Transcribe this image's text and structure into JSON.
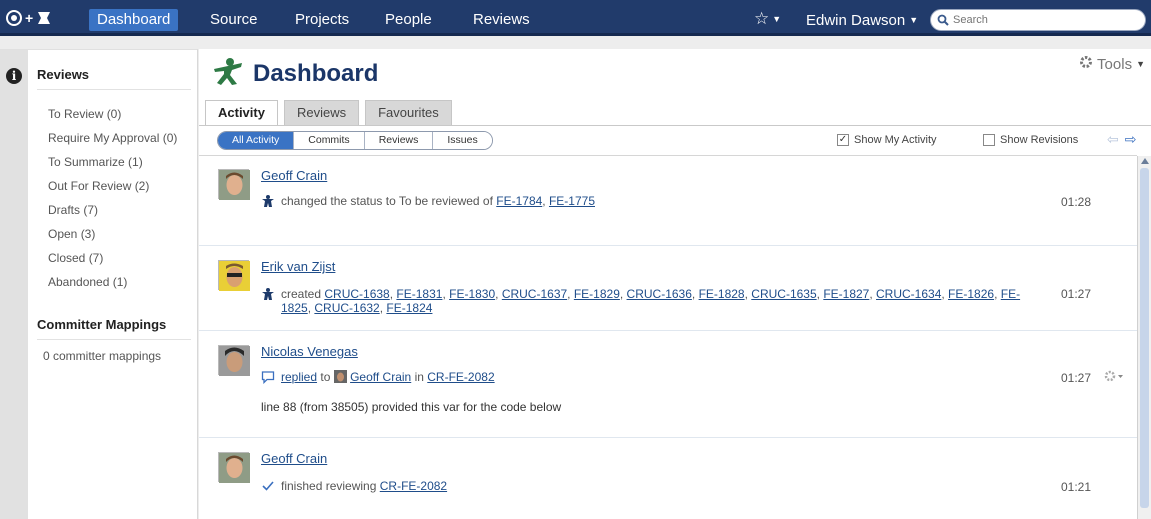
{
  "nav": {
    "items": [
      "Dashboard",
      "Source",
      "Projects",
      "People",
      "Reviews"
    ],
    "user": "Edwin Dawson",
    "search_placeholder": "Search"
  },
  "sidebar": {
    "reviews_title": "Reviews",
    "review_links": [
      "To Review (0)",
      "Require My Approval (0)",
      "To Summarize (1)",
      "Out For Review (2)",
      "Drafts (7)",
      "Open (3)",
      "Closed (7)",
      "Abandoned (1)"
    ],
    "mappings_title": "Committer Mappings",
    "mappings_text": "0 committer mappings"
  },
  "page": {
    "title": "Dashboard",
    "tools_label": "Tools",
    "tabs": [
      "Activity",
      "Reviews",
      "Favourites"
    ],
    "filters": [
      "All Activity",
      "Commits",
      "Reviews",
      "Issues"
    ],
    "show_my_activity": "Show My Activity",
    "show_my_activity_checked": true,
    "show_revisions": "Show Revisions",
    "show_revisions_checked": false
  },
  "activity": [
    {
      "author": "Geoff Crain",
      "text": "changed the status to To be reviewed of",
      "links": [
        "FE-1784",
        "FE-1775"
      ],
      "time": "01:28"
    },
    {
      "author": "Erik van Zijst",
      "text": "created",
      "links": [
        "CRUC-1638",
        "FE-1831",
        "FE-1830",
        "CRUC-1637",
        "FE-1829",
        "CRUC-1636",
        "FE-1828",
        "CRUC-1635",
        "FE-1827",
        "CRUC-1634",
        "FE-1826",
        "FE-1825",
        "CRUC-1632",
        "FE-1824"
      ],
      "time": "01:27"
    },
    {
      "author": "Nicolas Venegas",
      "replied": "replied",
      "to": "to",
      "target": "Geoff Crain",
      "in": "in",
      "review": "CR-FE-2082",
      "comment": "line 88 (from 38505) provided this var for the code below",
      "time": "01:27"
    },
    {
      "author": "Geoff Crain",
      "text": "finished reviewing",
      "review": "CR-FE-2082",
      "time": "01:21"
    }
  ]
}
